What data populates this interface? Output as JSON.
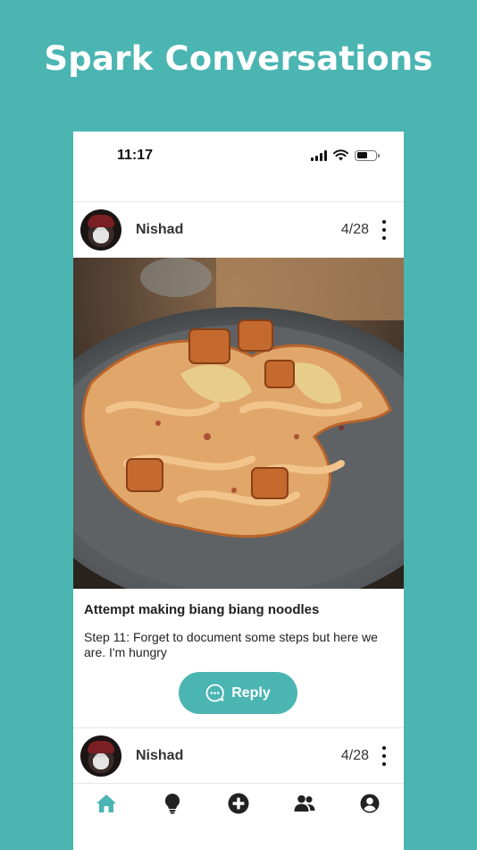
{
  "headline": "Spark Conversations",
  "status_bar": {
    "time": "11:17"
  },
  "posts": [
    {
      "username": "Nishad",
      "date": "4/28",
      "title": "Attempt making biang biang noodles",
      "body": "Step 11: Forget to document some steps but here we are. I'm hungry",
      "reply_label": "Reply"
    },
    {
      "username": "Nishad",
      "date": "4/28"
    }
  ],
  "tab_bar": {
    "items": [
      {
        "icon": "home-icon",
        "active": true
      },
      {
        "icon": "lightbulb-icon",
        "active": false
      },
      {
        "icon": "add-circle-icon",
        "active": false
      },
      {
        "icon": "people-icon",
        "active": false
      },
      {
        "icon": "profile-icon",
        "active": false
      }
    ]
  },
  "colors": {
    "brand": "#4bb5b2",
    "text": "#222222"
  }
}
